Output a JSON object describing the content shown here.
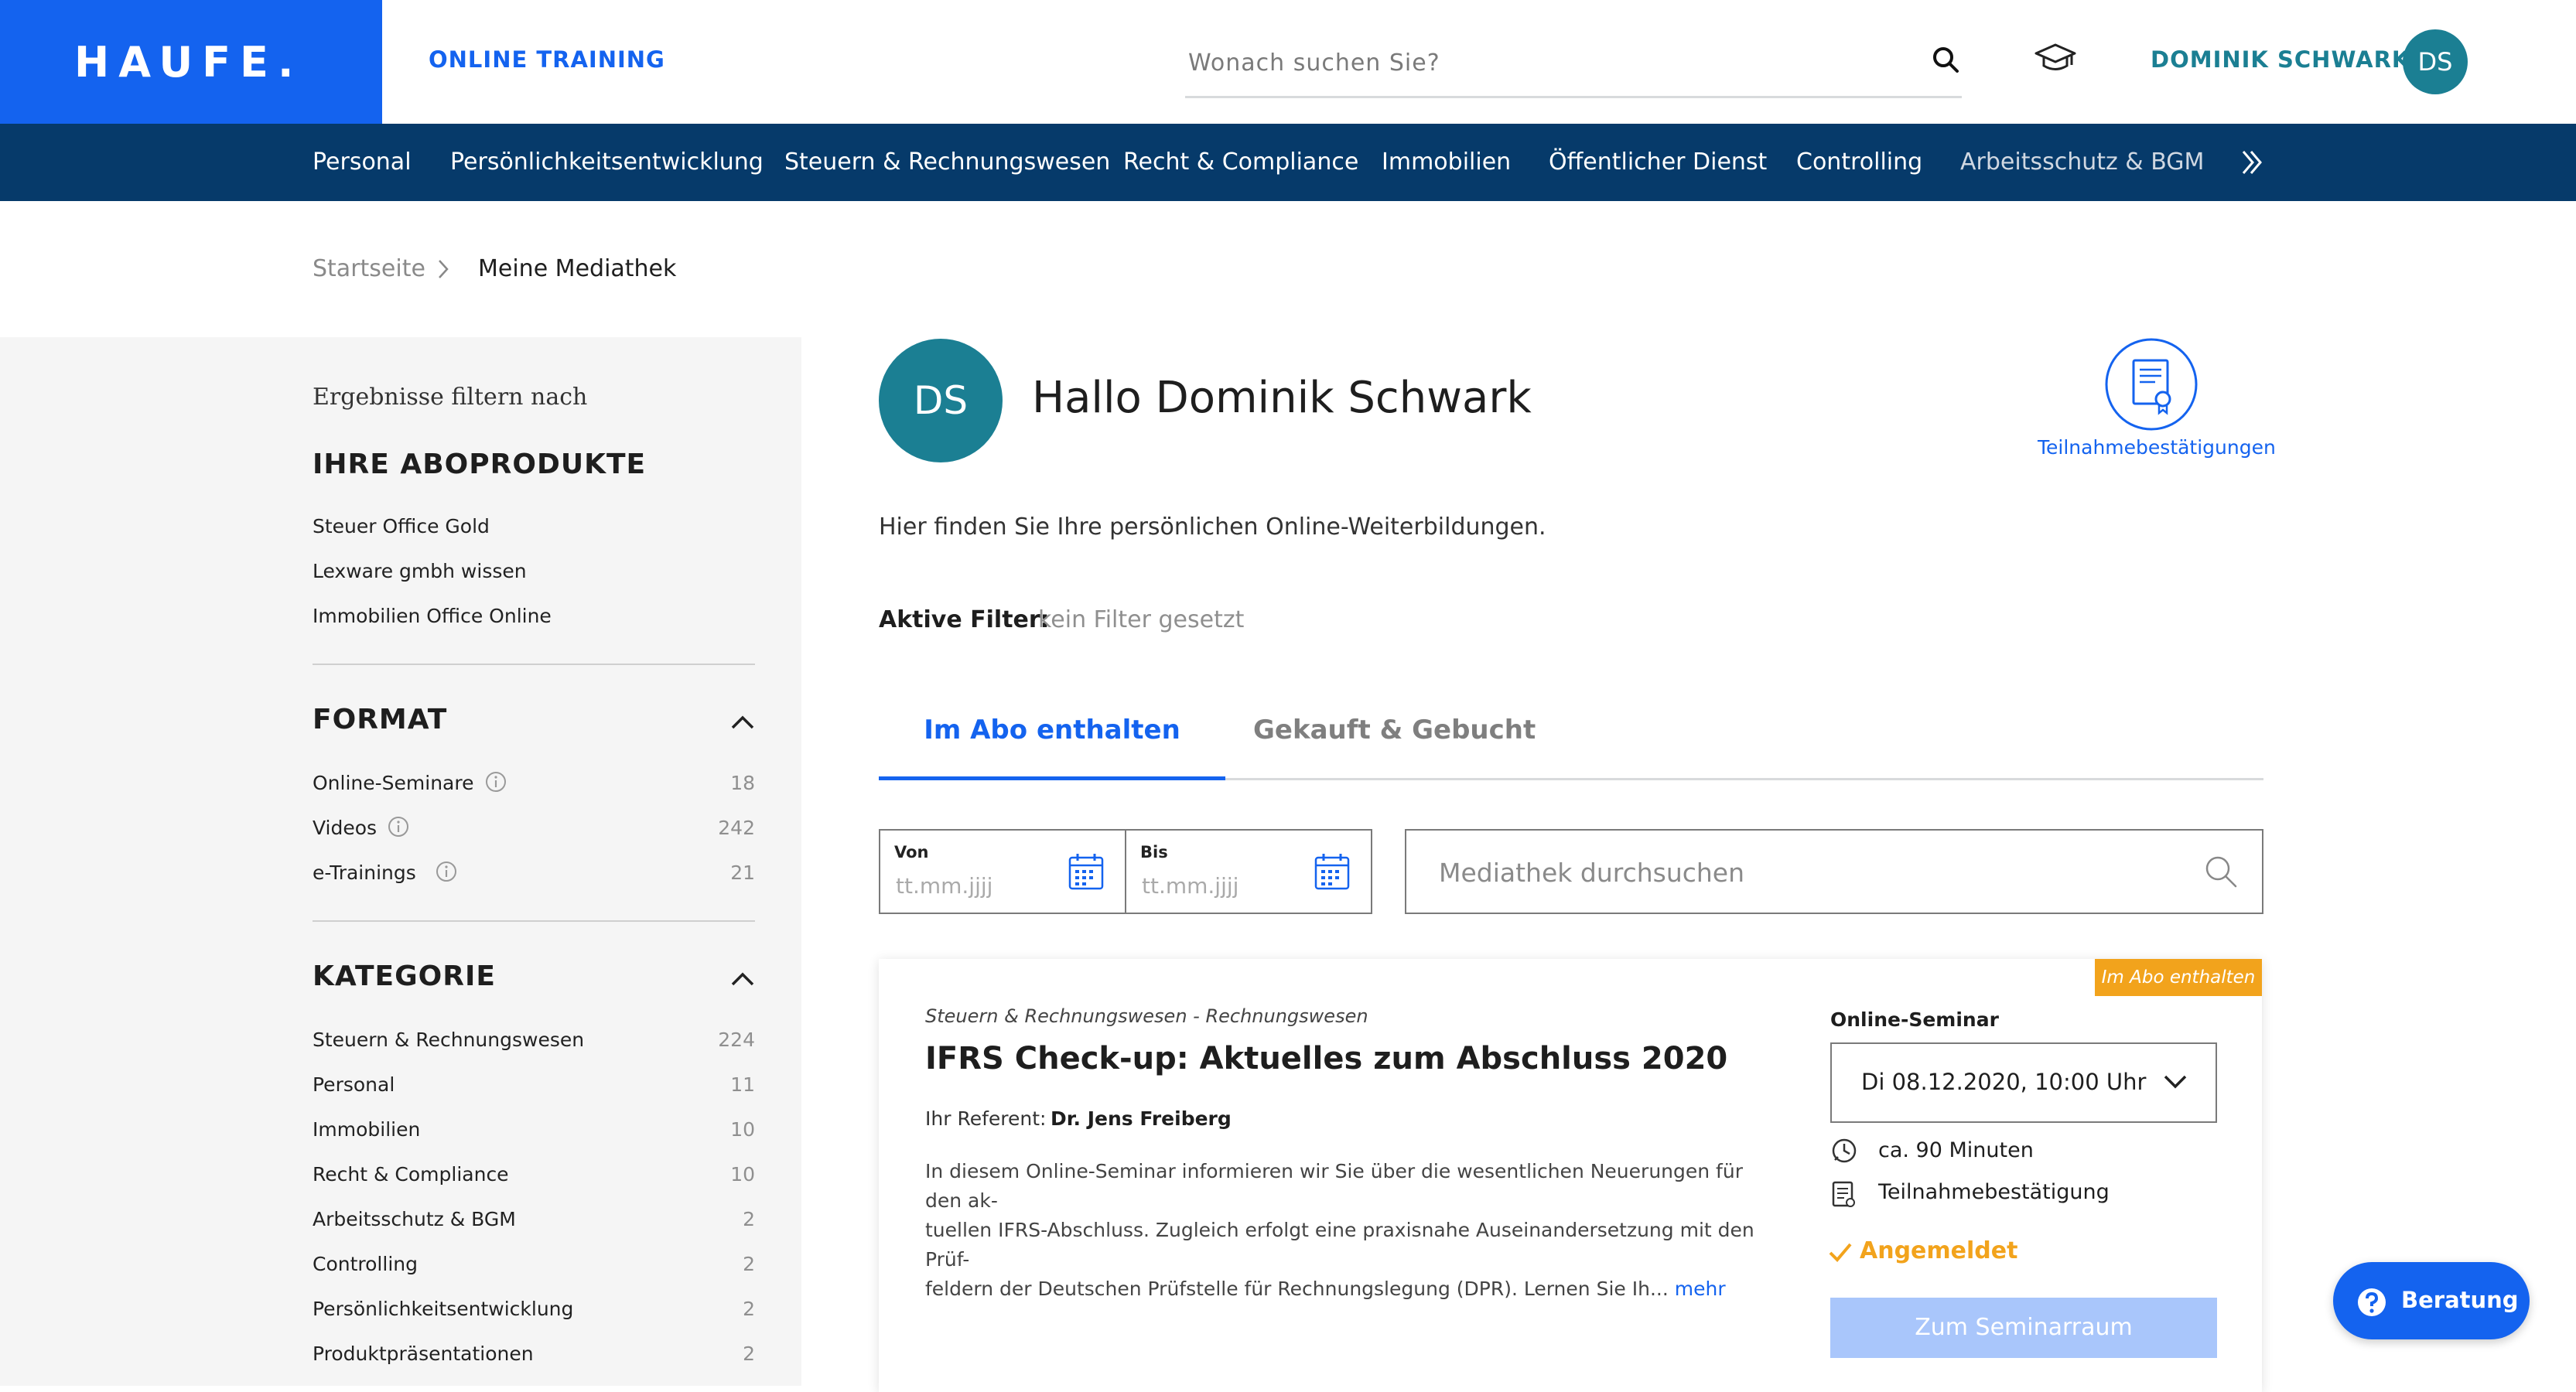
{
  "header": {
    "logo": "HAUFE.",
    "section": "ONLINE TRAINING",
    "search_placeholder": "Wonach suchen Sie?",
    "user_name": "DOMINIK SCHWARK",
    "user_initials": "DS"
  },
  "nav": {
    "items": [
      "Personal",
      "Persönlichkeitsentwicklung",
      "Steuern & Rechnungswesen",
      "Recht & Compliance",
      "Immobilien",
      "Öffentlicher Dienst",
      "Controlling",
      "Arbeitsschutz & BGM"
    ]
  },
  "breadcrumb": {
    "home": "Startseite",
    "current": "Meine Mediathek"
  },
  "sidebar": {
    "caption": "Ergebnisse filtern nach",
    "abo_heading": "IHRE ABOPRODUKTE",
    "abo_items": [
      "Steuer Office Gold",
      "Lexware gmbh wissen",
      "Immobilien Office Online"
    ],
    "format_heading": "FORMAT",
    "format_items": [
      {
        "label": "Online-Seminare",
        "count": "18"
      },
      {
        "label": "Videos",
        "count": "242"
      },
      {
        "label": "e-Trainings",
        "count": "21"
      }
    ],
    "kategorie_heading": "KATEGORIE",
    "kategorie_items": [
      {
        "label": "Steuern & Rechnungswesen",
        "count": "224"
      },
      {
        "label": "Personal",
        "count": "11"
      },
      {
        "label": "Immobilien",
        "count": "10"
      },
      {
        "label": "Recht & Compliance",
        "count": "10"
      },
      {
        "label": "Arbeitsschutz & BGM",
        "count": "2"
      },
      {
        "label": "Controlling",
        "count": "2"
      },
      {
        "label": "Persönlichkeitsentwicklung",
        "count": "2"
      },
      {
        "label": "Produktpräsentationen",
        "count": "2"
      }
    ]
  },
  "main": {
    "avatar_initials": "DS",
    "greeting": "Hallo Dominik Schwark",
    "cert_label": "Teilnahmebestätigungen",
    "intro": "Hier finden Sie Ihre persönlichen Online-Weiterbildungen.",
    "filter_label": "Aktive Filter:",
    "filter_value": "kein Filter gesetzt",
    "tabs": [
      {
        "label": "Im Abo enthalten",
        "active": true
      },
      {
        "label": "Gekauft & Gebucht",
        "active": false
      }
    ],
    "date_from_label": "Von",
    "date_to_label": "Bis",
    "date_placeholder": "tt.mm.jjjj",
    "media_search_placeholder": "Mediathek durchsuchen"
  },
  "card": {
    "badge": "Im Abo enthalten",
    "category": "Steuern & Rechnungswesen - Rechnungswesen",
    "title": "IFRS Check-up: Aktuelles zum Abschluss 2020",
    "referent_label": "Ihr Referent:",
    "referent_name": "Dr. Jens Freiberg",
    "description_lines": [
      "In diesem Online-Seminar informieren wir Sie über die wesentlichen Neuerungen für den ak-",
      "tuellen IFRS-Abschluss. Zugleich erfolgt eine praxisnahe Auseinandersetzung mit den Prüf-",
      "feldern der Deutschen Prüfstelle für Rechnungslegung (DPR). Lernen Sie Ih..."
    ],
    "more": "mehr",
    "format": "Online-Seminar",
    "date_selected": "Di 08.12.2020, 10:00 Uhr",
    "duration": "ca. 90 Minuten",
    "certificate": "Teilnahmebestätigung",
    "status": "Angemeldet",
    "room_button": "Zum Seminarraum"
  },
  "beratung": {
    "label": "Beratung"
  },
  "colors": {
    "brand_blue": "#1463ef",
    "nav_dark": "#063a6a",
    "teal": "#1b7f93",
    "orange": "#f2a31c"
  }
}
